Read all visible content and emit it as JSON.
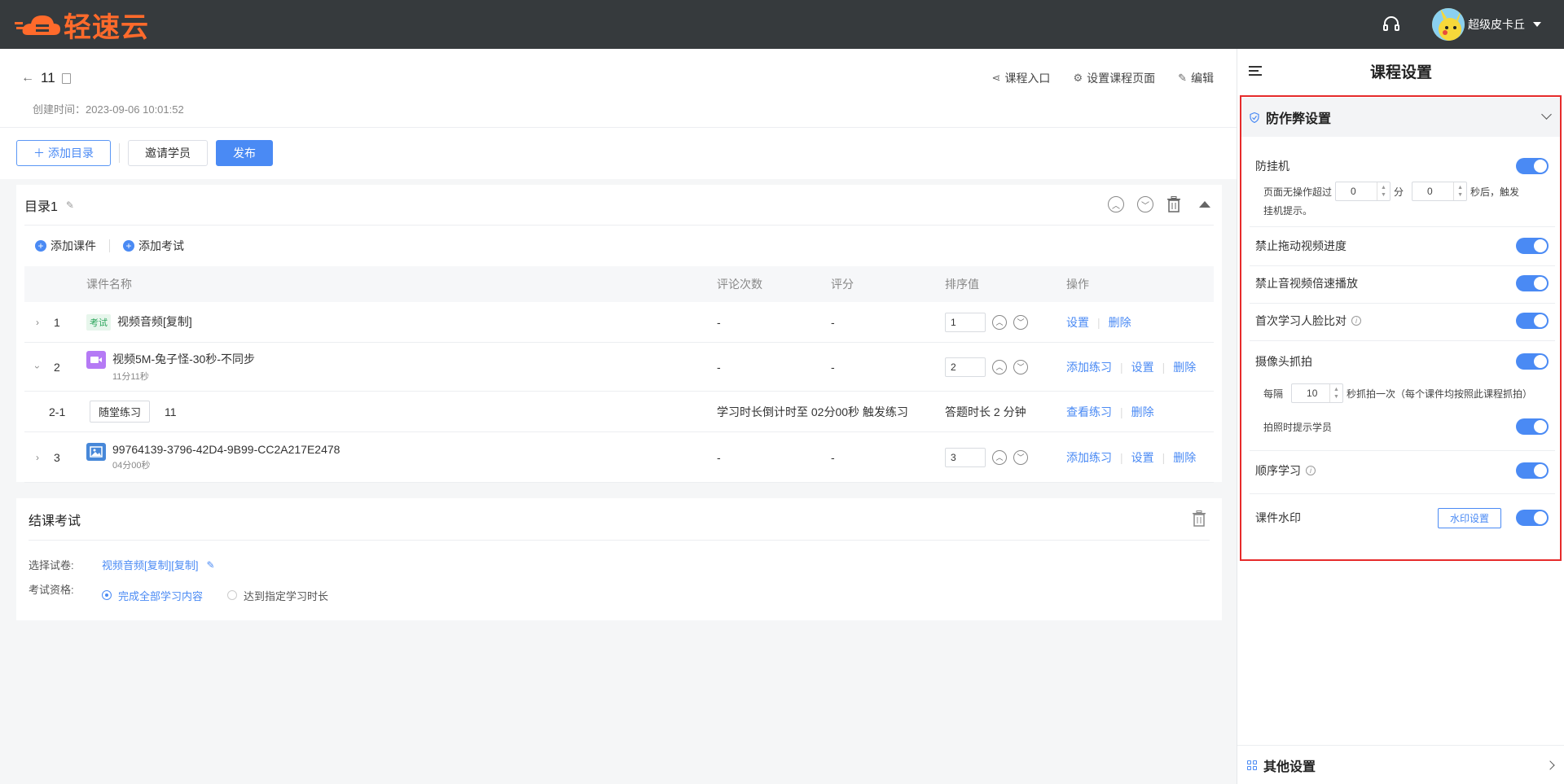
{
  "brand": {
    "name": "轻速云",
    "color": "#ff6a2b"
  },
  "topbar": {
    "username": "超级皮卡丘",
    "bg": "#363a3d"
  },
  "course": {
    "title": "11",
    "created": "创建时间：2023-09-06 10:01:52",
    "links": [
      "课程入口",
      "设置课程页面",
      "编辑"
    ]
  },
  "toolbar": {
    "add_catalog": "添加目录",
    "invite": "邀请学员",
    "publish": "发布"
  },
  "catalog": {
    "title": "目录1",
    "add_courseware": "添加课件",
    "add_exam": "添加考试",
    "columns": [
      "课件名称",
      "评论次数",
      "评分",
      "排序值",
      "操作"
    ],
    "rows": [
      {
        "idx": "1",
        "tag": "考试",
        "name": "视频音频[复制]",
        "sub": "",
        "comments": "-",
        "score": "-",
        "sort": "1",
        "ops": [
          "设置",
          "删除"
        ]
      },
      {
        "idx": "2",
        "tag": "",
        "name": "视频5M-兔子怪-30秒-不同步",
        "sub": "11分11秒",
        "comments": "-",
        "score": "-",
        "sort": "2",
        "ops": [
          "添加练习",
          "设置",
          "删除"
        ]
      },
      {
        "idx": "3",
        "tag": "",
        "name": "99764139-3796-42D4-9B99-CC2A217E2478",
        "sub": "04分00秒",
        "comments": "-",
        "score": "-",
        "sort": "3",
        "ops": [
          "添加练习",
          "设置",
          "删除"
        ]
      }
    ],
    "subrow": {
      "idx": "2-1",
      "button": "随堂练习",
      "name": "11",
      "trigger": "学习时长倒计时至 02分00秒 触发练习",
      "duration": "答题时长 2 分钟",
      "ops": [
        "查看练习",
        "删除"
      ]
    }
  },
  "final_exam": {
    "title": "结课考试",
    "paper_label": "选择试卷:",
    "paper_value": "视频音频[复制][复制]",
    "qual_label": "考试资格:",
    "option1": "完成全部学习内容",
    "option2": "达到指定学习时长"
  },
  "panel": {
    "title": "课程设置",
    "section": "防作弊设置",
    "anti_idle": "防挂机",
    "idle_prefix": "页面无操作超过",
    "idle_min": "0",
    "idle_min_unit": "分",
    "idle_sec": "0",
    "idle_suffix": "秒后，触发",
    "idle_suffix2": "挂机提示。",
    "no_drag": "禁止拖动视频进度",
    "no_speed": "禁止音视频倍速播放",
    "face": "首次学习人脸比对",
    "camera": "摄像头抓拍",
    "every": "每隔",
    "interval": "10",
    "interval_suffix": "秒抓拍一次（每个课件均按照此课程抓拍）",
    "notify": "拍照时提示学员",
    "sequential": "顺序学习",
    "watermark": "课件水印",
    "watermark_btn": "水印设置",
    "other": "其他设置"
  },
  "colors": {
    "accent": "#4a8af4",
    "highlight": "#e62b2b"
  }
}
